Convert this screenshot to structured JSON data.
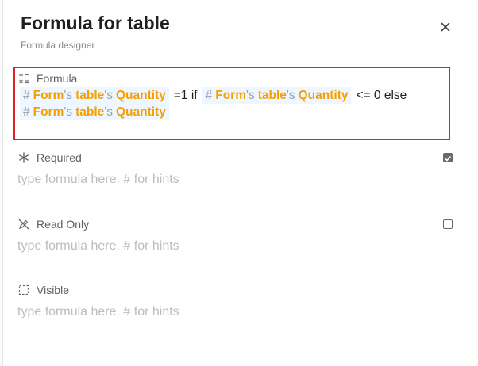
{
  "dialog": {
    "title": "Formula for table",
    "subtitle": "Formula designer"
  },
  "formula": {
    "label": "Formula",
    "line1": {
      "token1": {
        "hash": "#",
        "form": "Form",
        "s1": "'s",
        "table": "table",
        "s2": "'s",
        "field": "Quantity"
      },
      "op1": "=1 if",
      "token2": {
        "hash": "#",
        "form": "Form",
        "s1": "'s",
        "table": "table",
        "s2": "'s",
        "field": "Quantity"
      },
      "op2": "<= 0 else"
    },
    "line2": {
      "token3": {
        "hash": "#",
        "form": "Form",
        "s1": "'s",
        "table": "table",
        "s2": "'s",
        "field": "Quantity"
      }
    }
  },
  "required": {
    "label": "Required",
    "placeholder": "type formula here. # for hints",
    "checked": true
  },
  "read_only": {
    "label": "Read Only",
    "placeholder": "type formula here. # for hints",
    "checked": false
  },
  "visible": {
    "label": "Visible",
    "placeholder": "type formula here. # for hints"
  },
  "icons": {
    "close": "close-icon",
    "formula": "formula-icon",
    "required": "asterisk-icon",
    "read_only": "pencil-off-icon",
    "visible": "dashed-square-icon"
  },
  "colors": {
    "token": "#f5a000",
    "highlight_border": "#e0202a",
    "chip_bg": "#eef6ff"
  }
}
